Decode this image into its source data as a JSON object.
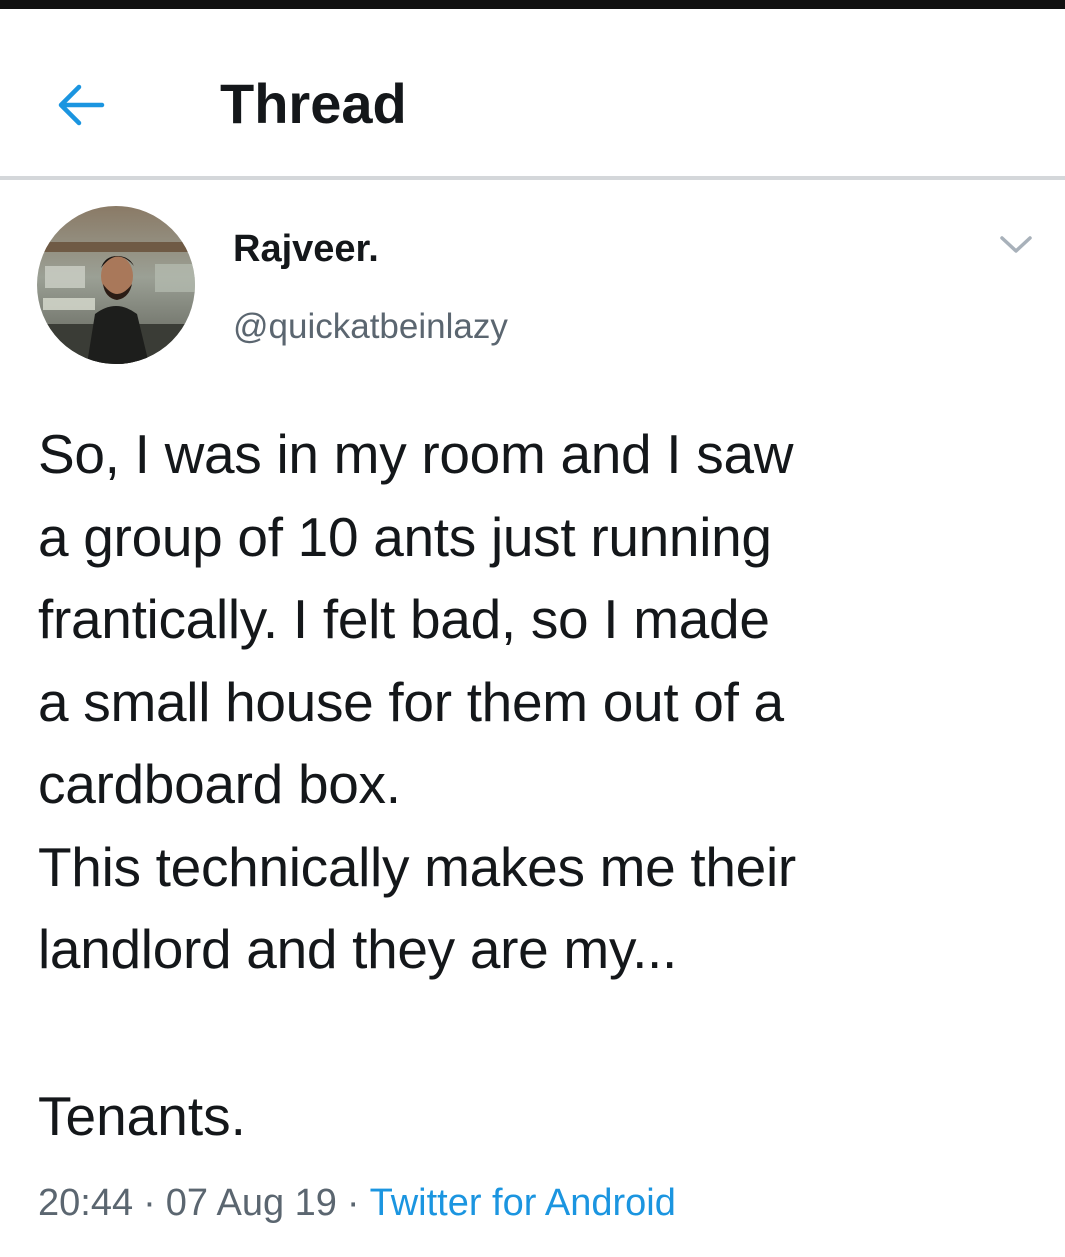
{
  "header": {
    "back_icon": "arrow-left-icon",
    "title": "Thread"
  },
  "tweet": {
    "author": {
      "display_name": "Rajveer.",
      "handle": "@quickatbeinlazy",
      "avatar_icon": "user-avatar-photo"
    },
    "more_icon": "chevron-down-icon",
    "text_lines": [
      "So, I was in my room and I saw",
      "a group of 10 ants just running",
      "frantically. I felt bad, so I made",
      "a small house for them out of a",
      "cardboard box.",
      "This technically makes me their",
      "landlord and they are my..."
    ],
    "punchline": "Tenants.",
    "meta": {
      "time": "20:44",
      "separator": "·",
      "date": "07 Aug 19",
      "source": "Twitter for Android"
    }
  },
  "colors": {
    "accent": "#1b95e0",
    "text_primary": "#14171a",
    "text_secondary": "#5b6670",
    "divider": "#d4d7da"
  }
}
